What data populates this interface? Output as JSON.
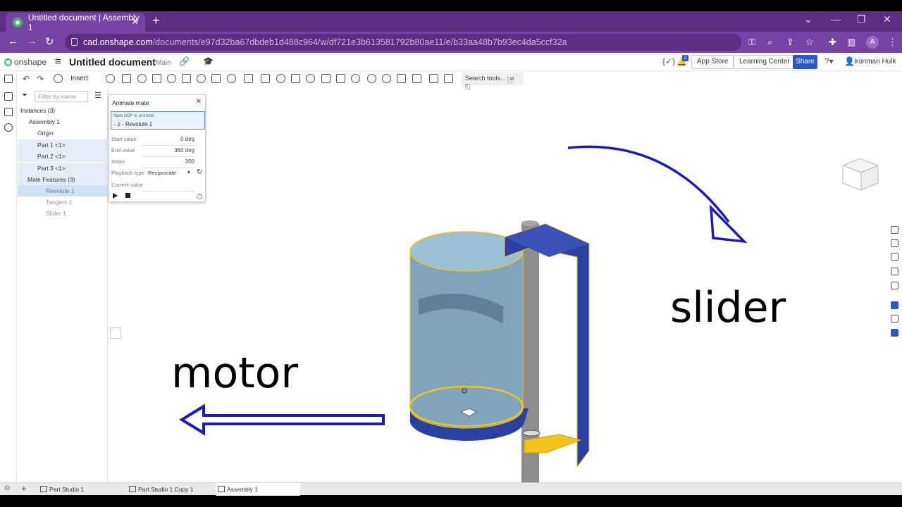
{
  "browser": {
    "tab_title": "Untitled document | Assembly 1",
    "url_host": "cad.onshape.com",
    "url_path": "/documents/e97d32ba67dbdeb1d488c964/w/df721e3b613581792b80ae11/e/b33aa48b7b93ec4da5ccf32a",
    "profile_initial": "A"
  },
  "app": {
    "logo": "onshape",
    "doc_title": "Untitled document",
    "branch": "Main",
    "notif_count": "2",
    "app_store": "App Store",
    "learning_center": "Learning Center",
    "share": "Share",
    "user_name": "Ironman Hulk"
  },
  "toolbar": {
    "insert": "Insert",
    "search_tools": "Search tools...",
    "shortcut": "alt C"
  },
  "feature_list": {
    "filter_placeholder": "Filter by name",
    "instances_header": "Instances (3)",
    "assembly": "Assembly 1",
    "origin": "Origin",
    "parts": [
      "Part 1 <1>",
      "Part 2 <1>",
      "Part 3 <1>"
    ],
    "mate_header": "Mate Features (3)",
    "mates": [
      "Revolute 1",
      "Tangent 1",
      "Slider 1"
    ]
  },
  "animate_dialog": {
    "title": "Animate mate",
    "dof_label": "Mate DOF to animate",
    "dof_value": "- z - Revolute 1",
    "start_label": "Start value",
    "start_value": "0 deg",
    "end_label": "End value",
    "end_value": "360 deg",
    "steps_label": "Steps",
    "steps_value": "300",
    "playback_label": "Playback type",
    "playback_value": "Reciprocate",
    "current_label": "Current value"
  },
  "viewport": {
    "motor_label": "motor",
    "slider_label": "slider",
    "arrow_color": "#1c1ab8",
    "part_blue": "#8fb3c8",
    "frame_blue": "#2a3f9e",
    "highlight": "#f2c318"
  },
  "bottom_tabs": [
    "Part Studio 1",
    "Part Studio 1 Copy 1",
    "Assembly 1"
  ]
}
